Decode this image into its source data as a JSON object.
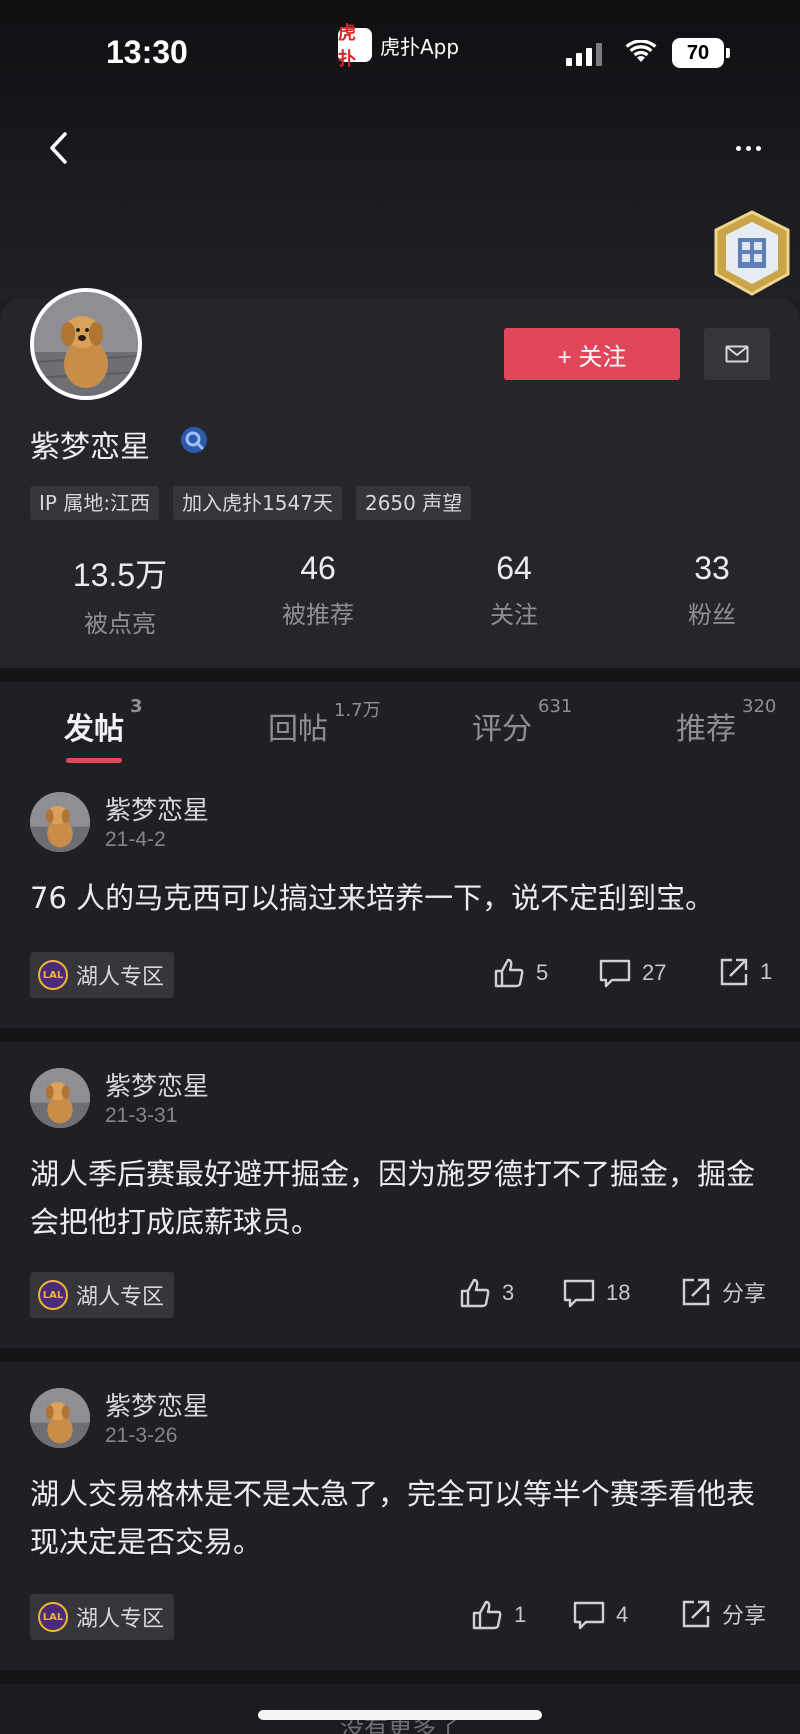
{
  "status_bar": {
    "time": "13:30",
    "app_name": "虎扑App",
    "app_logo_text": "虎扑",
    "battery": "70"
  },
  "nav": {
    "back_icon": "chevron-left-icon",
    "more_icon": "more-dots-icon"
  },
  "profile": {
    "username": "紫梦恋星",
    "follow_label": "+ 关注",
    "tags": [
      "IP 属地:江西",
      "加入虎扑1547天",
      "2650 声望"
    ],
    "stats": [
      {
        "value": "13.5万",
        "label": "被点亮"
      },
      {
        "value": "46",
        "label": "被推荐"
      },
      {
        "value": "64",
        "label": "关注"
      },
      {
        "value": "33",
        "label": "粉丝"
      }
    ]
  },
  "tabs": [
    {
      "label": "发帖",
      "count": "3",
      "active": true
    },
    {
      "label": "回帖",
      "count": "1.7万",
      "active": false
    },
    {
      "label": "评分",
      "count": "631",
      "active": false
    },
    {
      "label": "推荐",
      "count": "320",
      "active": false
    }
  ],
  "posts": [
    {
      "author": "紫梦恋星",
      "date": "21-4-2",
      "text": "76 人的马克西可以搞过来培养一下，说不定刮到宝。",
      "zone": "湖人专区",
      "likes": "5",
      "comments": "27",
      "shares": "1"
    },
    {
      "author": "紫梦恋星",
      "date": "21-3-31",
      "text": "湖人季后赛最好避开掘金，因为施罗德打不了掘金，掘金会把他打成底薪球员。",
      "zone": "湖人专区",
      "likes": "3",
      "comments": "18",
      "shares": "分享"
    },
    {
      "author": "紫梦恋星",
      "date": "21-3-26",
      "text": "湖人交易格林是不是太急了，完全可以等半个赛季看他表现决定是否交易。",
      "zone": "湖人专区",
      "likes": "1",
      "comments": "4",
      "shares": "分享"
    }
  ],
  "footer": {
    "no_more": "没有更多了"
  },
  "colors": {
    "accent": "#e1475a",
    "background": "#1b1c1f",
    "card": "#25262b"
  }
}
